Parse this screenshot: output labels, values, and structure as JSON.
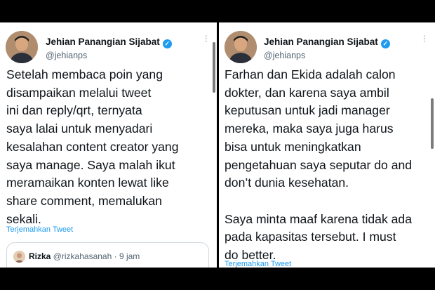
{
  "left_tweet": {
    "author_name": "Jehian Panangian Sijabat",
    "verified": true,
    "handle": "@jehianps",
    "text": "Setelah membaca poin yang\ndisampaikan melalui tweet\nini dan reply/qrt, ternyata\nsaya lalai untuk menyadari\nkesalahan content creator yang\nsaya manage. Saya malah ikut\nmeramaikan konten lewat like\nshare comment, memalukan\nsekali.",
    "translate_label": "Terjemahkan Tweet",
    "quoted": {
      "name": "Rizka",
      "handle": "@rizkahasanah",
      "time": "· 9 jam",
      "text_cut": ""
    }
  },
  "right_tweet": {
    "author_name": "Jehian Panangian Sijabat",
    "verified": true,
    "handle": "@jehianps",
    "text": "Farhan dan Ekida adalah calon\ndokter, dan karena saya ambil\nkeputusan untuk jadi manager\nmereka, maka saya juga harus\nbisa untuk meningkatkan\npengetahuan saya seputar do and\ndon’t dunia kesehatan.\n\nSaya minta maaf karena tidak ada\npada kapasitas tersebut. I must\ndo better.",
    "translate_label": "Terjemahkan Tweet"
  },
  "icons": {
    "verified": "verified-badge-icon",
    "more": "more-options-icon"
  },
  "colors": {
    "link_blue": "#1d9bf0",
    "text": "#0f1419",
    "secondary": "#536471",
    "frame": "#000000"
  }
}
